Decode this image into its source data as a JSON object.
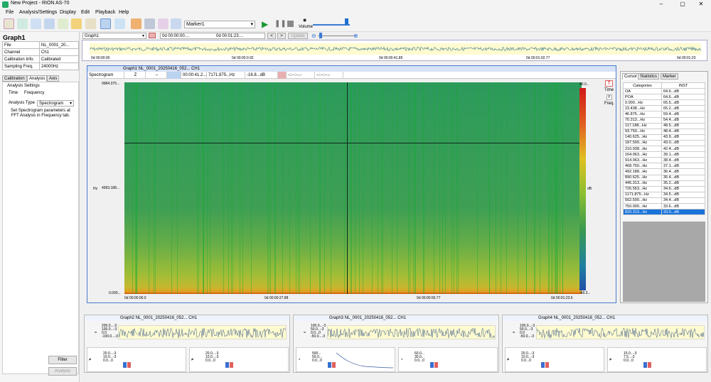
{
  "window": {
    "title": "New Project - RION AS-70"
  },
  "menu": [
    "File",
    "Analysis/Settings",
    "Display",
    "Edit",
    "Playback",
    "Help"
  ],
  "toolbar": {
    "marker_select": "Marker1",
    "volume_label": "Volume"
  },
  "graph_selector": {
    "value": "Graph1",
    "time_start": "0d 00:00:00....",
    "time_end": "0d 00:01:23....",
    "update_label": "Update"
  },
  "left": {
    "header": "Graph1",
    "props": [
      {
        "k": "File",
        "v": "NL_0001_20..."
      },
      {
        "k": "Channel",
        "v": "Ch1"
      },
      {
        "k": "Calibration Info.",
        "v": "Calibrated"
      },
      {
        "k": "Sampling Freq.",
        "v": "24000Hz"
      }
    ],
    "tabs": [
      "Calibration",
      "Analysis",
      "Axis"
    ],
    "analysis_settings": "Analysis Settings",
    "subtabs": [
      "Time",
      "Frequency"
    ],
    "analysis_type_label": "Analysis Type",
    "analysis_type_value": "Spectrogram",
    "note": "Set Spectrogram parameters at FFT Analysis in Frequency tab.",
    "filter_label": "Filter",
    "analysis_label": "Analysis"
  },
  "overview": {
    "ticks": [
      "0d 00:00:00",
      "0d 00:00:0.92",
      "0d 00:00:41.85",
      "0d 00:01:02.77",
      "0d 00:01:23"
    ]
  },
  "spectrogram": {
    "title": "Graph1 NL_0001_20250416_052... CH1",
    "ctrl": [
      "Spectrogram",
      "Z",
      "–",
      "00:00:41.2...",
      "7171.875...Hz",
      "-16.8...dB",
      "--:--:--.-",
      "--:--:--.-"
    ],
    "y_top": "9984.375...",
    "y_mid": "4993.188...",
    "y_bottom": "0.000...",
    "y_unit": "Hz",
    "x_ticks": [
      "0d 00:00:00.0",
      "0d 00:00:27.88",
      "0d 00:00:55.77",
      "0d 00:01:23.6"
    ],
    "cb_top": "90.0...",
    "cb_bottom": "-49.3...",
    "cb_unit": "dB",
    "side_time": "Time",
    "side_freq": "Freq."
  },
  "rightpanel": {
    "tabs": [
      "Cursor",
      "Statistics",
      "Marker"
    ],
    "headers": [
      "Categories",
      "INST"
    ],
    "rows": [
      [
        "OA",
        "64.6...dB"
      ],
      [
        "POA",
        "64.6...dB"
      ],
      [
        "0.000...Hz",
        "65.5...dB"
      ],
      [
        "23.438...Hz",
        "65.2...dB"
      ],
      [
        "46.875...Hz",
        "59.4...dB"
      ],
      [
        "70.313...Hz",
        "54.4...dB"
      ],
      [
        "117.188...Hz",
        "48.5...dB"
      ],
      [
        "93.750...Hz",
        "48.4...dB"
      ],
      [
        "140.625...Hz",
        "43.9...dB"
      ],
      [
        "187.500...Hz",
        "43.0...dB"
      ],
      [
        "210.938...Hz",
        "42.4...dB"
      ],
      [
        "164.063...Hz",
        "39.1...dB"
      ],
      [
        "914.063...Hz",
        "38.4...dB"
      ],
      [
        "468.750...Hz",
        "37.1...dB"
      ],
      [
        "492.188...Hz",
        "36.4...dB"
      ],
      [
        "890.625...Hz",
        "35.4...dB"
      ],
      [
        "445.313...Hz",
        "35.2...dB"
      ],
      [
        "726.563...Hz",
        "34.6...dB"
      ],
      [
        "1171.875...Hz",
        "34.5...dB"
      ],
      [
        "562.500...Hz",
        "34.4...dB"
      ],
      [
        "750.000...Hz",
        "33.6...dB"
      ],
      [
        "820.313...Hz",
        "33.0...dB"
      ]
    ]
  },
  "mini": [
    {
      "title": "Graph2 NL_0001_20250416_052... CH1",
      "y": [
        "200.0...-3",
        "100.0...-3",
        "0.0",
        "-100.0...-3"
      ],
      "box1": [
        "20.0...-3",
        "10.0...-3",
        "0.0...0"
      ],
      "box2": [
        "20.0...-3",
        "10.0...-3",
        "0.0...0"
      ]
    },
    {
      "title": "Graph3 NL_0001_20250416_052... CH1",
      "y": [
        "100.0...-3",
        "50.0...-3",
        "0.0...0",
        "-50.0...-3"
      ],
      "box1": [
        "500...",
        "50.0...",
        "0.0...0"
      ],
      "box2": [
        "60.0...",
        "30.0...",
        "0.0...0"
      ]
    },
    {
      "title": "Graph4 NL_0001_20250416_052... CH1",
      "y": [
        "100.0...-3",
        "50.0...-3",
        "0.0",
        "-50.0...-3"
      ],
      "box1": [
        "20.0...-3",
        "10.0...-3",
        "0.0...0"
      ],
      "box2": [
        "15.0...-3",
        "7.5...-3",
        "0.0...0"
      ]
    }
  ],
  "colors": {
    "accent": "#1a73d9",
    "frame": "#4a7ad0"
  }
}
